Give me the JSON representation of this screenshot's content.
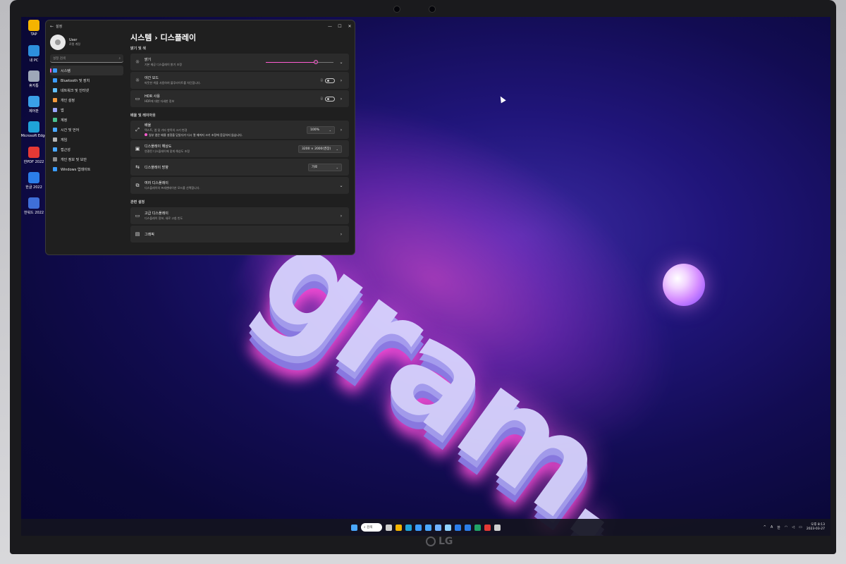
{
  "desktop": {
    "icons": [
      {
        "label": "TAP",
        "icon": "folder-icon",
        "color": "#f4b400"
      },
      {
        "label": "내 PC",
        "icon": "computer-icon",
        "color": "#2d8fdc"
      },
      {
        "label": "휴지통",
        "icon": "recycle-bin-icon",
        "color": "#9ea8b8"
      },
      {
        "label": "제어판",
        "icon": "control-panel-icon",
        "color": "#3aa0e8"
      },
      {
        "label": "Microsoft Edge",
        "icon": "edge-icon",
        "color": "#1fa3d9"
      },
      {
        "label": "한PDF 2022",
        "icon": "hanpdf-icon",
        "color": "#e53935"
      },
      {
        "label": "한글 2022",
        "icon": "hangul-icon",
        "color": "#2b7de9"
      },
      {
        "label": "한워드 2022",
        "icon": "hanword-icon",
        "color": "#3f6fd8"
      }
    ],
    "wallpaper_text": "gram."
  },
  "window": {
    "title": "설정",
    "controls": {
      "minimize": "—",
      "maximize": "☐",
      "close": "✕"
    },
    "profile": {
      "name": "User",
      "account": "로컬 계정"
    },
    "search_placeholder": "설정 검색",
    "nav": [
      {
        "label": "시스템",
        "icon": "system-icon",
        "color": "#3b9cff",
        "active": true
      },
      {
        "label": "Bluetooth 및 장치",
        "icon": "bluetooth-icon",
        "color": "#3b9cff",
        "active": false
      },
      {
        "label": "네트워크 및 인터넷",
        "icon": "network-icon",
        "color": "#60c0ff",
        "active": false
      },
      {
        "label": "개인 설정",
        "icon": "personalization-icon",
        "color": "#f59a3c",
        "active": false
      },
      {
        "label": "앱",
        "icon": "apps-icon",
        "color": "#9aa6ff",
        "active": false
      },
      {
        "label": "계정",
        "icon": "accounts-icon",
        "color": "#49c08f",
        "active": false
      },
      {
        "label": "시간 및 언어",
        "icon": "time-language-icon",
        "color": "#4aa8ff",
        "active": false
      },
      {
        "label": "게임",
        "icon": "gaming-icon",
        "color": "#b4b4b4",
        "active": false
      },
      {
        "label": "접근성",
        "icon": "accessibility-icon",
        "color": "#4aa8ff",
        "active": false
      },
      {
        "label": "개인 정보 및 보안",
        "icon": "privacy-icon",
        "color": "#8d8d8d",
        "active": false
      },
      {
        "label": "Windows 업데이트",
        "icon": "update-icon",
        "color": "#3b9cff",
        "active": false
      }
    ],
    "breadcrumb": "시스템 › 디스플레이",
    "sections": {
      "brightness_color": "밝기 및 색",
      "scale_layout": "배율 및 레이아웃",
      "related": "관련 설정"
    },
    "brightness": {
      "title": "밝기",
      "desc": "기본 제공 디스플레이 밝기 조정",
      "value_fraction": 0.74
    },
    "night_light": {
      "title": "야간 모드",
      "desc": "따뜻한 색을 사용하여 블루라이트를 차단합니다.",
      "state_label": "끔"
    },
    "hdr": {
      "title": "HDR 사용",
      "desc": "HDR에 대한 자세한 정보",
      "state_label": "끔"
    },
    "scale": {
      "title": "배율",
      "desc": "텍스트, 앱 및 기타 항목의 크기 변경",
      "warning": "일부 앱은 배율 설정을 닫았다가 다시 열 때까지 크기 조정에 응답하지 않습니다.",
      "value": "100%"
    },
    "resolution": {
      "title": "디스플레이 해상도",
      "desc": "연결된 디스플레이에 맞게 해상도 조정",
      "value": "3200 × 2000(권장)"
    },
    "orientation": {
      "title": "디스플레이 방향",
      "value": "가로"
    },
    "multi_display": {
      "title": "여러 디스플레이",
      "desc": "디스플레이의 프레젠테이션 모드를 선택합니다."
    },
    "advanced": {
      "title": "고급 디스플레이",
      "desc": "디스플레이 정보, 새로 고침 빈도"
    },
    "graphics": {
      "title": "그래픽"
    }
  },
  "taskbar": {
    "search_label": "검색",
    "apps": [
      {
        "icon": "task-view-icon",
        "color": "#cfcfcf"
      },
      {
        "icon": "file-explorer-icon",
        "color": "#f4b400"
      },
      {
        "icon": "edge-icon",
        "color": "#1fa3d9"
      },
      {
        "icon": "store-icon",
        "color": "#3b9cff"
      },
      {
        "icon": "cortana-icon",
        "color": "#4aa8ff"
      },
      {
        "icon": "photos-icon",
        "color": "#6fb1ff"
      },
      {
        "icon": "mail-icon",
        "color": "#8fd3ff"
      },
      {
        "icon": "calendar-icon",
        "color": "#2b7de9"
      },
      {
        "icon": "hangul-icon",
        "color": "#2b7de9"
      },
      {
        "icon": "excel-icon",
        "color": "#21a366"
      },
      {
        "icon": "hanpdf-icon",
        "color": "#e53935"
      },
      {
        "icon": "settings-icon",
        "color": "#cfcfcf"
      }
    ],
    "tray": {
      "chevron": "^",
      "keyboard": "A",
      "ime": "한"
    },
    "clock": {
      "time": "오후 8:13",
      "date": "2023-03-27"
    }
  },
  "device": {
    "brand": "LG"
  }
}
